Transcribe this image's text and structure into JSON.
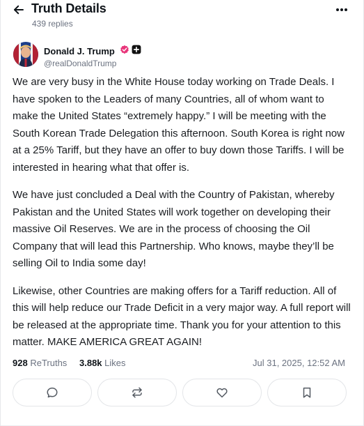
{
  "header": {
    "title": "Truth Details",
    "replies": "439 replies",
    "back_icon": "arrow-left-icon",
    "more_icon": "more-horizontal-icon"
  },
  "author": {
    "name": "Donald J. Trump",
    "handle": "@realDonaldTrump",
    "verified_color": "#e8357a",
    "badges": [
      "verified-badge-icon",
      "plus-badge-icon"
    ]
  },
  "post": {
    "paragraphs": [
      "We are very busy in the White House today working on Trade Deals. I have spoken to the Leaders of many Countries, all of whom want to make the United States “extremely happy.” I will be meeting with the South Korean Trade Delegation this afternoon. South Korea is right now at a 25% Tariff, but they have an offer to buy down those Tariffs. I will be interested in hearing what that offer is.",
      "We have just concluded a Deal with the Country of Pakistan, whereby Pakistan and the United States will work together on developing their massive Oil Reserves. We are in the process of choosing the Oil Company that will lead this Partnership. Who knows, maybe they’ll be selling Oil to India some day!",
      "Likewise, other Countries are making offers for a Tariff reduction. All of this will help reduce our Trade Deficit in a very major way. A full report will be released at the appropriate time. Thank you for your attention to this matter. MAKE AMERICA GREAT AGAIN!"
    ]
  },
  "stats": {
    "retruths_count": "928",
    "retruths_label": "ReTruths",
    "likes_count": "3.88k",
    "likes_label": "Likes",
    "timestamp": "Jul 31, 2025, 12:52 AM"
  },
  "actions": [
    {
      "name": "reply-button",
      "icon": "reply-bubble-icon"
    },
    {
      "name": "retruth-button",
      "icon": "retruth-icon"
    },
    {
      "name": "like-button",
      "icon": "heart-icon"
    },
    {
      "name": "bookmark-button",
      "icon": "bookmark-icon"
    }
  ]
}
